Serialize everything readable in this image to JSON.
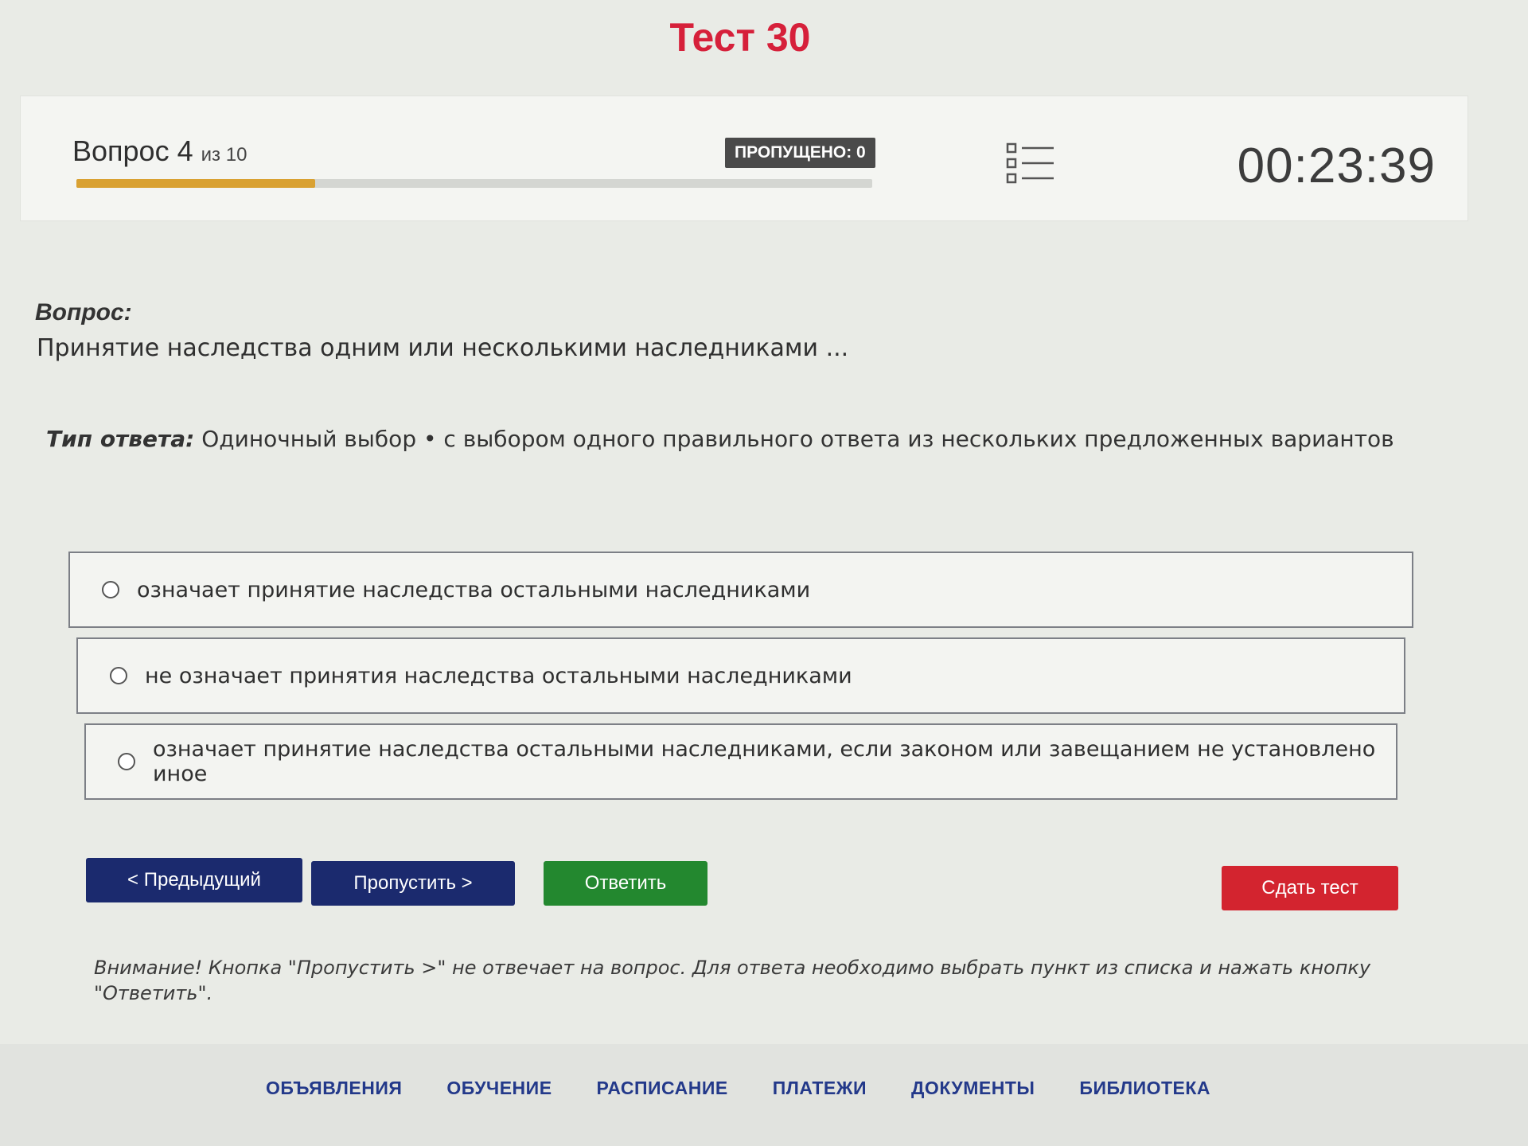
{
  "page": {
    "title": "Тест 30"
  },
  "header": {
    "question_word": "Вопрос",
    "question_number": "4",
    "question_of": "из 10",
    "progress_fraction": 0.3,
    "skipped_label": "ПРОПУЩЕНО: 0",
    "timer": "00:23:39",
    "list_icon": "question-list-icon"
  },
  "question": {
    "label": "Вопрос:",
    "text": "Принятие наследства одним или несколькими наследниками ...",
    "answer_type_label": "Тип ответа:",
    "answer_type_value": "Одиночный выбор • с выбором одного правильного ответа из нескольких предложенных вариантов"
  },
  "options": [
    {
      "text": "означает принятие наследства остальными наследниками",
      "selected": false
    },
    {
      "text": "не означает принятия наследства остальными наследниками",
      "selected": false
    },
    {
      "text": "означает принятие наследства остальными наследниками, если законом или завещанием не установлено иное",
      "selected": false
    }
  ],
  "buttons": {
    "prev": "< Предыдущий",
    "skip": "Пропустить >",
    "answer": "Ответить",
    "submit": "Сдать тест"
  },
  "warning": "Внимание! Кнопка \"Пропустить >\" не отвечает на вопрос. Для ответа необходимо выбрать пункт из списка и нажать кнопку \"Ответить\".",
  "footer": {
    "nav": [
      "ОБЪЯВЛЕНИЯ",
      "ОБУЧЕНИЕ",
      "РАСПИСАНИЕ",
      "ПЛАТЕЖИ",
      "ДОКУМЕНТЫ",
      "БИБЛИОТЕКА"
    ]
  },
  "colors": {
    "title": "#d6203a",
    "progress": "#d9a132",
    "primary_button": "#1b2a6e",
    "answer_button": "#23882f",
    "submit_button": "#d3242f",
    "footer_link": "#23398a"
  }
}
